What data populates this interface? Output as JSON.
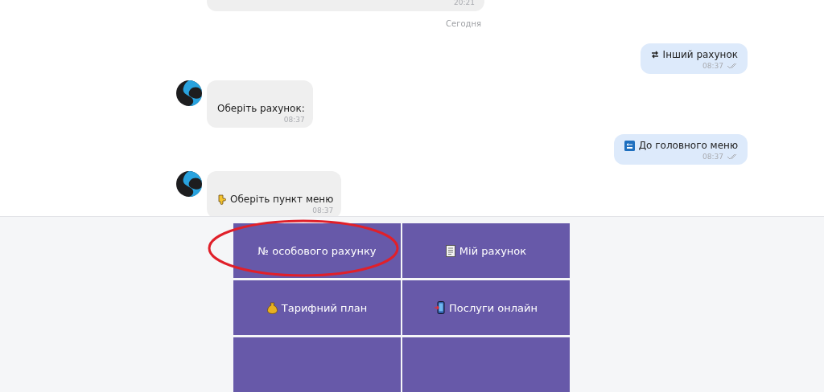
{
  "messages": [
    {
      "kind": "incoming_cut",
      "time": "20:21"
    },
    {
      "kind": "date",
      "text": "Сегодня"
    },
    {
      "kind": "outgoing",
      "text": "Інший рахунок",
      "time": "08:37",
      "read": true
    },
    {
      "kind": "incoming",
      "text": "Оберіть рахунок:",
      "time": "08:37"
    },
    {
      "kind": "outgoing",
      "text": "До головного меню",
      "time": "08:37",
      "read": true
    },
    {
      "kind": "incoming",
      "text": "Оберіть пункт меню",
      "time": "08:37"
    }
  ],
  "keyboard": [
    {
      "kind": "key",
      "label": "№ особового рахунку",
      "highlighted": true
    },
    {
      "kind": "key",
      "label": "Мій рахунок",
      "highlighted": false
    },
    {
      "kind": "key",
      "label": "Тарифний план",
      "highlighted": false
    },
    {
      "kind": "key",
      "label": "Послуги онлайн",
      "highlighted": false
    },
    {
      "kind": "cut_off"
    },
    {
      "kind": "cut_off"
    }
  ]
}
